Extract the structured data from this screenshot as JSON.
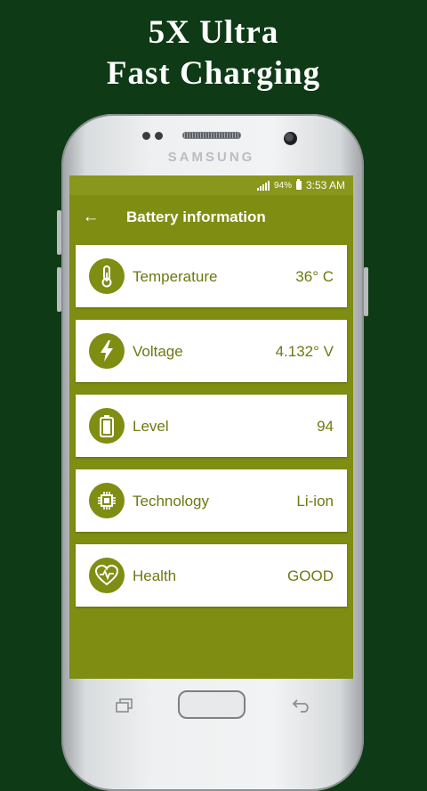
{
  "promo": {
    "line1": "5X Ultra",
    "line2": "Fast Charging"
  },
  "device": {
    "brand": "SAMSUNG"
  },
  "statusbar": {
    "battery_percent": "94%",
    "time": "3:53 AM"
  },
  "appbar": {
    "title": "Battery information",
    "back_icon": "arrow-left-icon"
  },
  "items": [
    {
      "label": "Temperature",
      "value": "36° C",
      "icon": "thermometer-icon"
    },
    {
      "label": "Voltage",
      "value": "4.132° V",
      "icon": "lightning-icon"
    },
    {
      "label": "Level",
      "value": "94",
      "icon": "battery-icon"
    },
    {
      "label": "Technology",
      "value": "Li-ion",
      "icon": "chip-icon"
    },
    {
      "label": "Health",
      "value": "GOOD",
      "icon": "heart-pulse-icon"
    }
  ],
  "colors": {
    "background": "#0e3a16",
    "accent": "#7f8d12",
    "text": "#6f7812"
  }
}
